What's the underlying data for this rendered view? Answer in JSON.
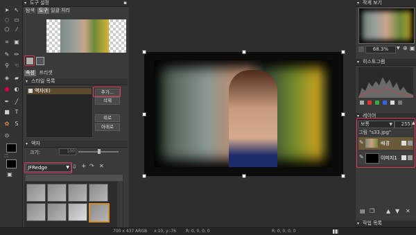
{
  "left_panel": {
    "title": "도구 설정",
    "tabs": [
      "탐색",
      "도구",
      "일괄 처리"
    ],
    "mode_tabs": [
      "속성",
      "프리셋"
    ],
    "style_list_header": "스타일 목록",
    "style_item": "액자(E)",
    "buttons": {
      "add": "추가...",
      "delete": "삭제",
      "up": "위로",
      "down": "아래로"
    },
    "frame_section": "액자",
    "size_label": "크기:",
    "size_value": "100",
    "frame_select": "JFRedge"
  },
  "right_panel": {
    "navigator_title": "작게 보기",
    "zoom": "68.3%",
    "histogram_title": "히스토그램",
    "layers_title": "레이어",
    "blend_mode": "보통",
    "opacity": "255",
    "group_label": "그림 \"s33.jpg\"",
    "layers": [
      {
        "name": "배경"
      },
      {
        "name": "이미지1"
      }
    ],
    "history_title": "작업 목록"
  },
  "status_bar": {
    "size": "700 x 437 ARGB",
    "pos": "x:10, y:-76",
    "rgb1": "R: 0, 0, 0, 0",
    "rgb2": "R: 0, 0, 0, 0"
  },
  "colors": {
    "accent": "#e0375a",
    "panel": "#3a3a3a",
    "bg": "#2b2b2b"
  }
}
